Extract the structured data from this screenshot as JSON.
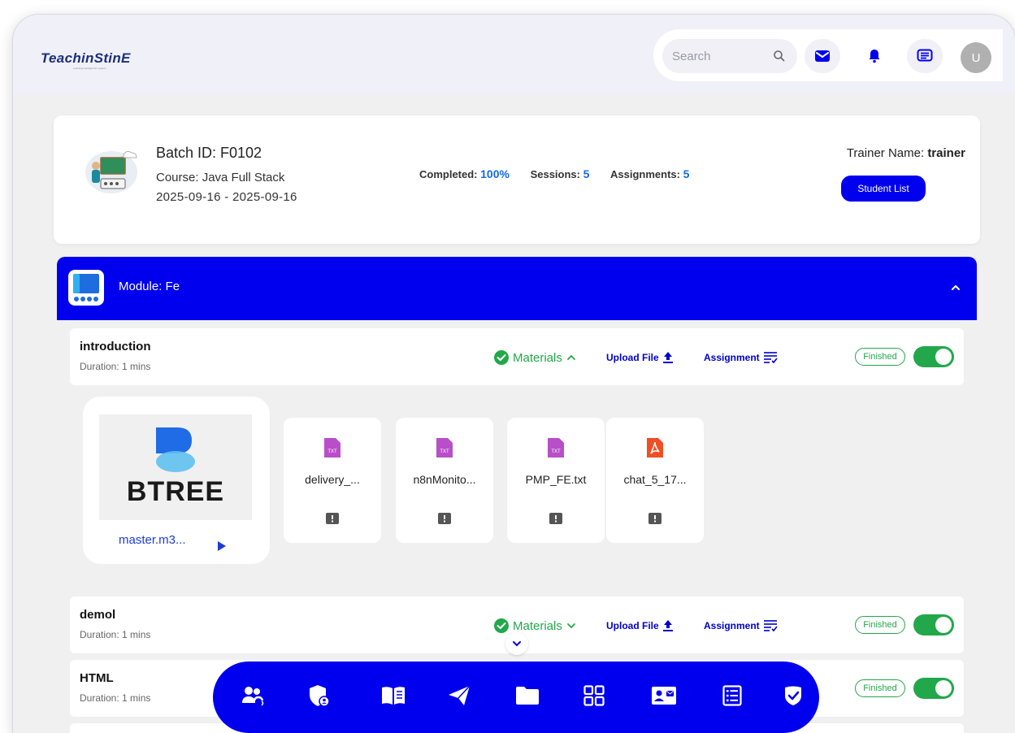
{
  "header": {
    "logo_text": "TeachinStinE",
    "logo_tagline": "Learning management system",
    "search_placeholder": "Search",
    "avatar_initial": "U"
  },
  "batch": {
    "batch_id": "Batch ID: F0102",
    "course": "Course: Java Full Stack",
    "dates": "2025-09-16 - 2025-09-16",
    "completed_label": "Completed:",
    "completed_value": "100%",
    "sessions_label": "Sessions:",
    "sessions_value": "5",
    "assignments_label": "Assignments:",
    "assignments_value": "5",
    "trainer_label": "Trainer Name:",
    "trainer_value": "trainer",
    "student_list_label": "Student List"
  },
  "module": {
    "title": "Module: Fe"
  },
  "sessions": [
    {
      "title": "introduction",
      "duration": "Duration: 1 mins",
      "materials": "Materials",
      "upload": "Upload File",
      "assignment": "Assignment",
      "status": "Finished"
    },
    {
      "title": "demol",
      "duration": "Duration: 1 mins",
      "materials": "Materials",
      "upload": "Upload File",
      "assignment": "Assignment",
      "status": "Finished"
    },
    {
      "title": "HTML",
      "duration": "Duration: 1 mins",
      "status": "Finished"
    }
  ],
  "materials": {
    "video": {
      "brand": "BTREE",
      "name": "master.m3..."
    },
    "files": [
      {
        "name": "delivery_...",
        "type": "TXT"
      },
      {
        "name": "n8nMonito...",
        "type": "TXT"
      },
      {
        "name": "PMP_FE.txt",
        "type": "TXT"
      },
      {
        "name": "chat_5_17...",
        "type": "PDF"
      }
    ]
  },
  "colors": {
    "primary": "#0000ee",
    "success": "#22a84a",
    "link": "#1769e8",
    "txt_icon": "#b84fc8",
    "pdf_icon": "#f04e23"
  },
  "dock_icons": [
    "users-voice-icon",
    "shield-user-icon",
    "book-icon",
    "send-icon",
    "folder-icon",
    "grid-icon",
    "contact-card-icon",
    "list-icon",
    "check-shield-icon"
  ]
}
